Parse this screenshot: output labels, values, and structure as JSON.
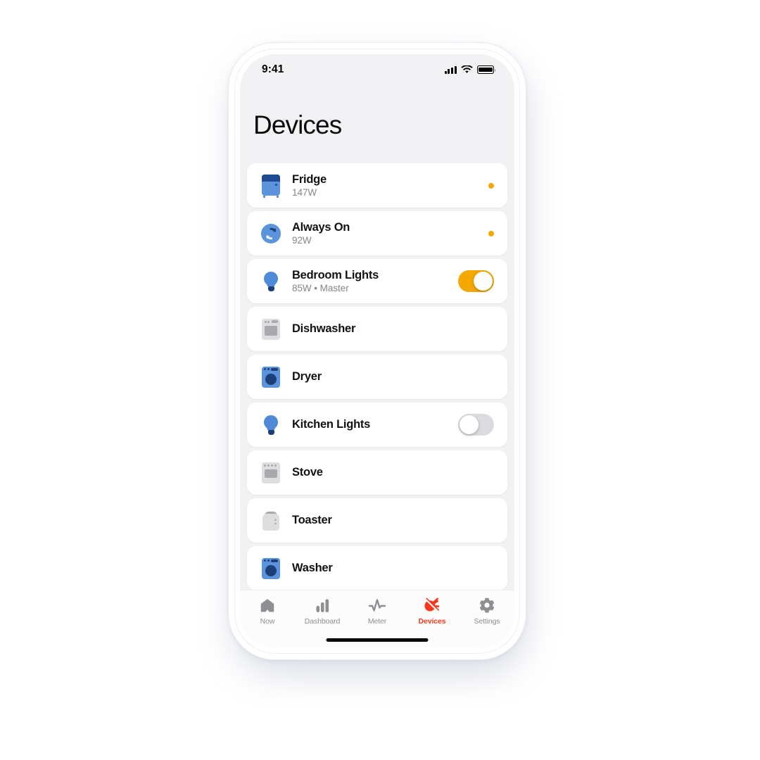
{
  "statusbar": {
    "time": "9:41",
    "cellular_icon": "signal-bars-icon",
    "wifi_icon": "wifi-icon",
    "battery_icon": "battery-full-icon"
  },
  "header": {
    "title": "Devices"
  },
  "colors": {
    "accent_amber": "#f5a800",
    "accent_red": "#f6381d",
    "blue": "#5b93dd",
    "blue_dark": "#1d3f77",
    "grey_icon": "#a8a8ad",
    "screen_bg": "#f2f2f4",
    "card_bg": "#ffffff"
  },
  "devices": [
    {
      "name": "Fridge",
      "sub": "147W",
      "icon": "fridge-icon",
      "control": "dot",
      "toggle_state": ""
    },
    {
      "name": "Always On",
      "sub": "92W",
      "icon": "always-on-icon",
      "control": "dot",
      "toggle_state": ""
    },
    {
      "name": "Bedroom Lights",
      "sub": "85W • Master",
      "icon": "lightbulb-icon",
      "control": "toggle",
      "toggle_state": "on"
    },
    {
      "name": "Dishwasher",
      "sub": "",
      "icon": "dishwasher-icon",
      "control": "none",
      "toggle_state": ""
    },
    {
      "name": "Dryer",
      "sub": "",
      "icon": "dryer-icon",
      "control": "none",
      "toggle_state": ""
    },
    {
      "name": "Kitchen Lights",
      "sub": "",
      "icon": "lightbulb-icon",
      "control": "toggle",
      "toggle_state": "off"
    },
    {
      "name": "Stove",
      "sub": "",
      "icon": "stove-icon",
      "control": "none",
      "toggle_state": ""
    },
    {
      "name": "Toaster",
      "sub": "",
      "icon": "toaster-icon",
      "control": "none",
      "toggle_state": ""
    },
    {
      "name": "Washer",
      "sub": "",
      "icon": "washer-icon",
      "control": "none",
      "toggle_state": ""
    }
  ],
  "tabbar": {
    "items": [
      {
        "label": "Now",
        "icon": "home-icon",
        "active": false
      },
      {
        "label": "Dashboard",
        "icon": "bar-chart-icon",
        "active": false
      },
      {
        "label": "Meter",
        "icon": "pulse-icon",
        "active": false
      },
      {
        "label": "Devices",
        "icon": "plug-icon",
        "active": true
      },
      {
        "label": "Settings",
        "icon": "gear-icon",
        "active": false
      }
    ]
  }
}
